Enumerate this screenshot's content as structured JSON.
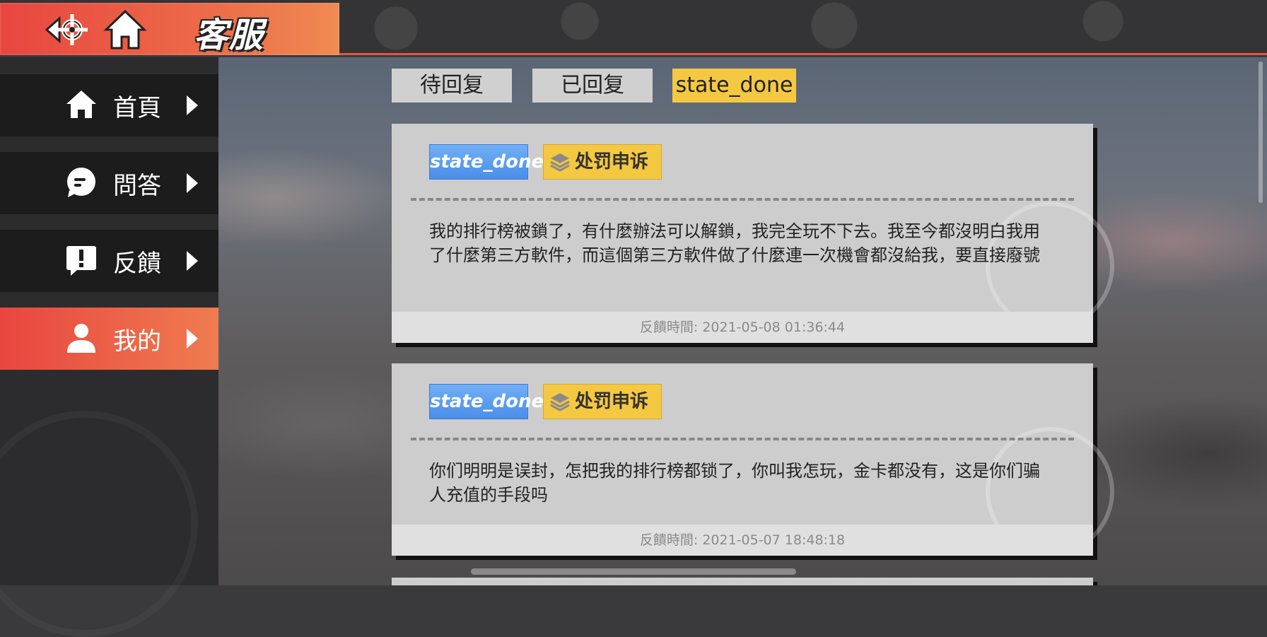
{
  "header": {
    "title": "客服",
    "back_icon": "helm-back-icon",
    "home_icon": "home-icon"
  },
  "sidebar": {
    "items": [
      {
        "label": "首頁",
        "icon": "home-icon"
      },
      {
        "label": "問答",
        "icon": "chat-bubble-icon"
      },
      {
        "label": "反饋",
        "icon": "exclamation-icon"
      },
      {
        "label": "我的",
        "icon": "user-icon",
        "active": true
      }
    ]
  },
  "tabs": [
    {
      "label": "待回复"
    },
    {
      "label": "已回复"
    },
    {
      "label": "state_done",
      "active": true
    }
  ],
  "cards": [
    {
      "state": "state_done",
      "type": "处罚申诉",
      "text": "我的排行榜被鎖了，有什麼辦法可以解鎖，我完全玩不下去。我至今都沒明白我用了什麼第三方軟件，而這個第三方軟件做了什麼連一次機會都沒給我，要直接廢號",
      "time": "反饋時間: 2021-05-08 01:36:44"
    },
    {
      "state": "state_done",
      "type": "处罚申诉",
      "text": "你们明明是误封，怎把我的排行榜都锁了，你叫我怎玩，金卡都没有，这是你们骗人充值的手段吗",
      "time": "反饋時間: 2021-05-07 18:48:18"
    }
  ],
  "colors": {
    "accent": "#e8463f",
    "state_badge": "#5a9bee",
    "type_badge": "#f5c842",
    "sidebar_bg": "#1c1c1d"
  }
}
